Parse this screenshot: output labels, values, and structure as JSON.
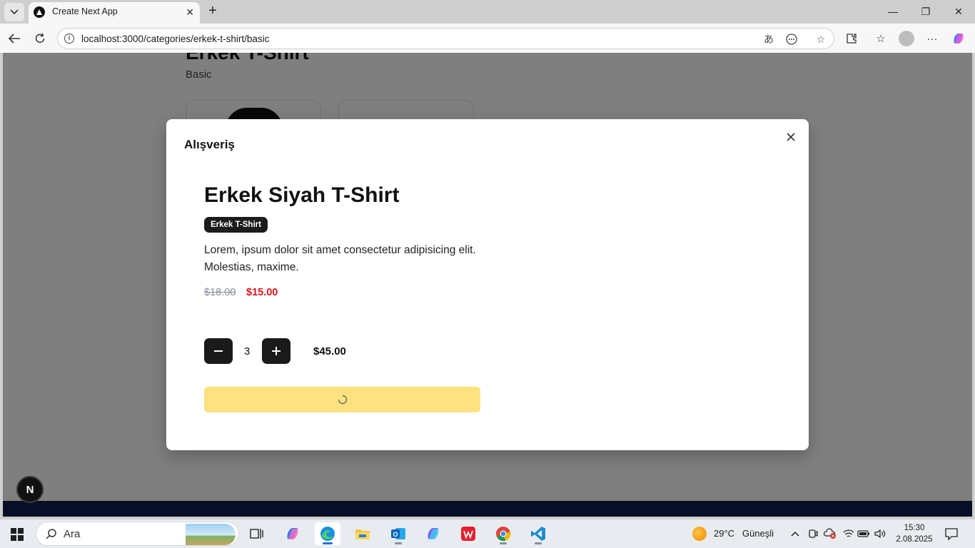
{
  "browser": {
    "tab_title": "Create Next App",
    "url": "localhost:3000/categories/erkek-t-shirt/basic"
  },
  "page": {
    "category_title": "Erkek T-Shirt",
    "subcategory": "Basic",
    "footer_color": "#0f1e4f"
  },
  "modal": {
    "title": "Alışveriş",
    "product_name": "Erkek Siyah T-Shirt",
    "category_badge": "Erkek T-Shirt",
    "description": "Lorem, ipsum dolor sit amet consectetur adipisicing elit. Molestias, maxime.",
    "old_price": "$18.00",
    "new_price": "$15.00",
    "quantity": "3",
    "total": "$45.00",
    "add_button_state": "loading",
    "accent_color": "#fde27f",
    "sale_color": "#d8141f"
  },
  "dev_badge": "N",
  "taskbar": {
    "search_label": "Ara",
    "weather_temp": "29°C",
    "weather_desc": "Güneşli",
    "time": "15:30",
    "date": "2.08.2025",
    "apps": [
      "task-view",
      "copilot",
      "edge",
      "file-explorer",
      "outlook",
      "copilot-app",
      "wps-office",
      "chrome",
      "vscode"
    ]
  }
}
